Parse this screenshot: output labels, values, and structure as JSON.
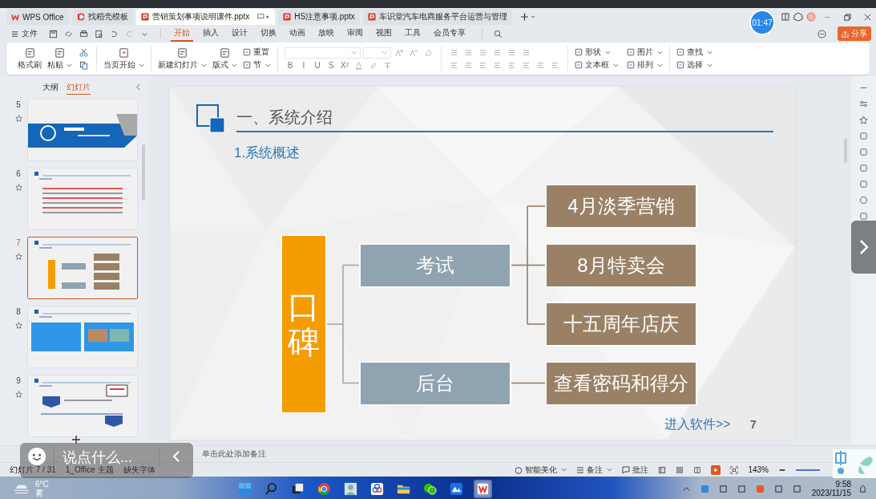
{
  "window": {
    "tabs": [
      {
        "label": "WPS Office",
        "kind": "home",
        "selected": false
      },
      {
        "label": "找稻壳模板",
        "kind": "template",
        "selected": false
      },
      {
        "label": "营销策划事项说明课件.pptx",
        "kind": "pptx",
        "selected": true
      },
      {
        "label": "HS注意事项.pptx",
        "kind": "pptx",
        "selected": false
      },
      {
        "label": "车识堂汽车电商服务平台运营与管理",
        "kind": "pptx",
        "selected": false
      }
    ],
    "clock": "01:47",
    "share": "分享"
  },
  "menu": {
    "file": "文件",
    "ribbon_tabs": [
      {
        "label": "开始",
        "selected": true
      },
      {
        "label": "插入",
        "selected": false
      },
      {
        "label": "设计",
        "selected": false
      },
      {
        "label": "切换",
        "selected": false
      },
      {
        "label": "动画",
        "selected": false
      },
      {
        "label": "放映",
        "selected": false
      },
      {
        "label": "审阅",
        "selected": false
      },
      {
        "label": "视图",
        "selected": false
      },
      {
        "label": "工具",
        "selected": false
      },
      {
        "label": "会员专享",
        "selected": false
      }
    ]
  },
  "ribbon": {
    "groups": [
      {
        "kind": "tools",
        "tools": [
          {
            "label": "格式刷",
            "kind": "large",
            "dropdown": false
          },
          {
            "label": "粘贴",
            "kind": "large",
            "dropdown": true
          }
        ]
      },
      {
        "kind": "tools",
        "tools": [
          {
            "label": "当页开始",
            "kind": "large",
            "dropdown": true
          }
        ]
      },
      {
        "kind": "tools",
        "tools": [
          {
            "label": "新建幻灯片",
            "kind": "large",
            "dropdown": true
          },
          {
            "label": "版式",
            "kind": "large",
            "dropdown": true
          },
          {
            "label": "重置",
            "kind": "small",
            "dropdown": false
          },
          {
            "label": "节",
            "kind": "small",
            "dropdown": true
          }
        ]
      },
      {
        "kind": "font",
        "buttons": [
          "B",
          "I",
          "U",
          "S",
          "X²"
        ]
      },
      {
        "kind": "paragraph"
      },
      {
        "kind": "tools",
        "tools": [
          {
            "label": "形状",
            "kind": "small",
            "dropdown": true
          },
          {
            "label": "文本框",
            "kind": "small",
            "dropdown": true
          },
          {
            "label": "图片",
            "kind": "small",
            "dropdown": true
          },
          {
            "label": "排列",
            "kind": "small",
            "dropdown": true
          }
        ]
      },
      {
        "kind": "tools",
        "tools": [
          {
            "label": "查找",
            "kind": "small",
            "dropdown": true
          },
          {
            "label": "选择",
            "kind": "small",
            "dropdown": true
          }
        ]
      }
    ]
  },
  "panel": {
    "tabs": [
      {
        "label": "大纲",
        "selected": false
      },
      {
        "label": "幻灯片",
        "selected": true
      }
    ],
    "slides": [
      {
        "number": "5",
        "kind": "cover",
        "selected": false
      },
      {
        "number": "6",
        "kind": "text",
        "selected": false
      },
      {
        "number": "7",
        "kind": "diagram",
        "selected": true
      },
      {
        "number": "8",
        "kind": "images",
        "selected": false
      },
      {
        "number": "9",
        "kind": "mixed",
        "selected": false
      }
    ]
  },
  "slide": {
    "title": "一、系统介绍",
    "subtitle": "1.系统概述",
    "root": "口碑",
    "branches": [
      {
        "label": "考试",
        "children": [
          {
            "label": "4月淡季营销"
          },
          {
            "label": "8月特卖会"
          },
          {
            "label": "十五周年店庆"
          }
        ]
      },
      {
        "label": "后台",
        "children": [
          {
            "label": "查看密码和得分"
          }
        ]
      }
    ],
    "link": "进入软件>>",
    "page": "7"
  },
  "notes": {
    "placeholder": "单击此处添加备注"
  },
  "status_bar": {
    "slide_count": "幻灯片 7 / 31",
    "theme": "1_Office 主题",
    "missing_fonts": "缺失字体",
    "beautify": "智能美化",
    "notes": "备注",
    "comments": "批注",
    "zoom": "143%"
  },
  "comment_bar": {
    "placeholder": "说点什么..."
  },
  "taskbar": {
    "weather_temp": "6°C",
    "weather_text": "雾",
    "time": "9:58",
    "date": "2023/11/15"
  }
}
